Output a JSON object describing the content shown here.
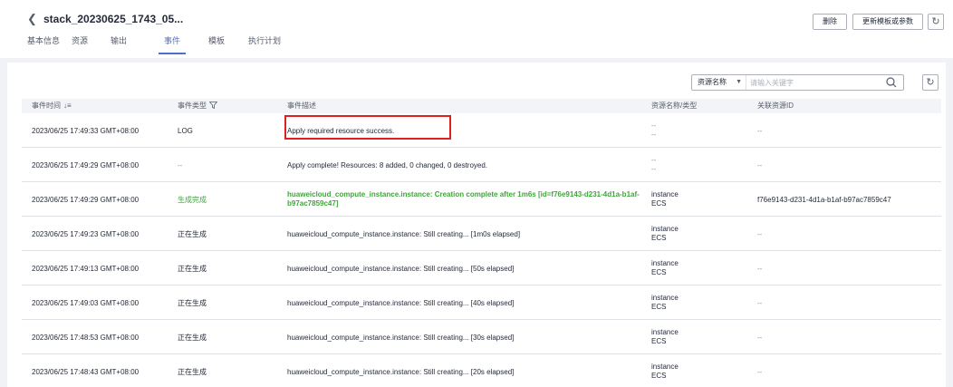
{
  "header": {
    "back_icon": "chevron-left-icon",
    "title": "stack_20230625_1743_05...",
    "buttons": {
      "delete": "删除",
      "update": "更新模板或参数"
    },
    "refresh_icon": "refresh-icon"
  },
  "tabs": [
    {
      "label": "基本信息",
      "active": false
    },
    {
      "label": "资源",
      "active": false
    },
    {
      "label": "输出",
      "active": false
    },
    {
      "label": "事件",
      "active": true
    },
    {
      "label": "模板",
      "active": false
    },
    {
      "label": "执行计划",
      "active": false
    }
  ],
  "filter": {
    "select_value": "资源名称",
    "placeholder": "请输入关键字"
  },
  "table": {
    "columns": {
      "time": "事件时间",
      "type": "事件类型",
      "desc": "事件描述",
      "resource": "资源名称/类型",
      "related": "关联资源ID"
    },
    "rows": [
      {
        "time": "2023/06/25 17:49:33 GMT+08:00",
        "type": "LOG",
        "desc": "Apply required resource success.",
        "res_name": "--",
        "res_type": "--",
        "related": "--"
      },
      {
        "time": "2023/06/25 17:49:29 GMT+08:00",
        "type": "--",
        "desc": "Apply complete! Resources: 8 added, 0 changed, 0 destroyed.",
        "res_name": "--",
        "res_type": "--",
        "related": "--"
      },
      {
        "time": "2023/06/25 17:49:29 GMT+08:00",
        "type": "生成完成",
        "desc": "huaweicloud_compute_instance.instance: Creation complete after 1m6s [id=f76e9143-d231-4d1a-b1af-b97ac7859c47]",
        "res_name": "instance",
        "res_type": "ECS",
        "related": "f76e9143-d231-4d1a-b1af-b97ac7859c47"
      },
      {
        "time": "2023/06/25 17:49:23 GMT+08:00",
        "type": "正在生成",
        "desc": "huaweicloud_compute_instance.instance: Still creating... [1m0s elapsed]",
        "res_name": "instance",
        "res_type": "ECS",
        "related": "--"
      },
      {
        "time": "2023/06/25 17:49:13 GMT+08:00",
        "type": "正在生成",
        "desc": "huaweicloud_compute_instance.instance: Still creating... [50s elapsed]",
        "res_name": "instance",
        "res_type": "ECS",
        "related": "--"
      },
      {
        "time": "2023/06/25 17:49:03 GMT+08:00",
        "type": "正在生成",
        "desc": "huaweicloud_compute_instance.instance: Still creating... [40s elapsed]",
        "res_name": "instance",
        "res_type": "ECS",
        "related": "--"
      },
      {
        "time": "2023/06/25 17:48:53 GMT+08:00",
        "type": "正在生成",
        "desc": "huaweicloud_compute_instance.instance: Still creating... [30s elapsed]",
        "res_name": "instance",
        "res_type": "ECS",
        "related": "--"
      },
      {
        "time": "2023/06/25 17:48:43 GMT+08:00",
        "type": "正在生成",
        "desc": "huaweicloud_compute_instance.instance: Still creating... [20s elapsed]",
        "res_name": "instance",
        "res_type": "ECS",
        "related": "--"
      }
    ]
  },
  "colors": {
    "accent": "#526ecc",
    "success": "#3fa63a",
    "highlight": "#e02020"
  }
}
